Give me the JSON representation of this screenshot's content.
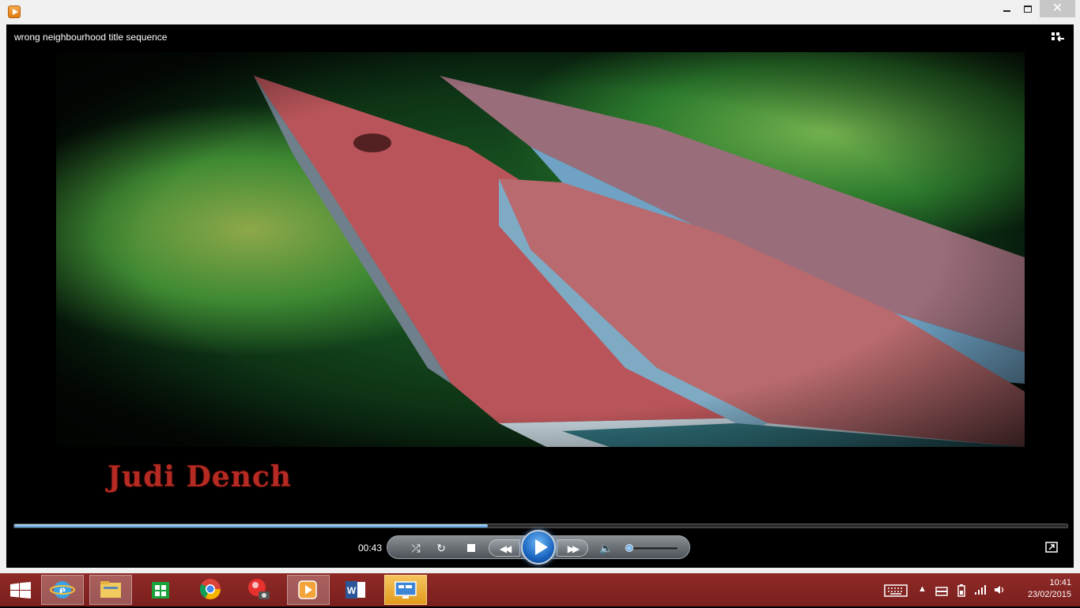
{
  "window": {
    "title": "wrong neighbourhood title sequence",
    "controls": [
      "minimize",
      "maximize",
      "close"
    ]
  },
  "video": {
    "credit_text": "Judi Dench"
  },
  "player": {
    "elapsed": "00:43",
    "progress": 0.45,
    "volume": 0.08,
    "buttons": [
      "shuffle-icon",
      "repeat-icon",
      "stop-icon",
      "previous-icon",
      "play-icon",
      "next-icon",
      "volume-icon",
      "fullscreen-icon",
      "switch-to-library-icon"
    ]
  },
  "taskbar": {
    "apps": [
      "start-icon",
      "internet-explorer-icon",
      "file-explorer-icon",
      "store-icon",
      "chrome-icon",
      "snipping-tool-icon",
      "windows-media-player-icon",
      "word-icon",
      "remote-desktop-icon"
    ],
    "clock_time": "10:41",
    "clock_date": "23/02/2015",
    "tray": [
      "keyboard-icon",
      "show-hidden-icon",
      "action-center-icon",
      "battery-icon",
      "network-icon",
      "volume-icon"
    ]
  },
  "colors": {
    "taskbar": "#8f2a27",
    "credit": "#b52a22",
    "progress": "#4a96d8"
  }
}
